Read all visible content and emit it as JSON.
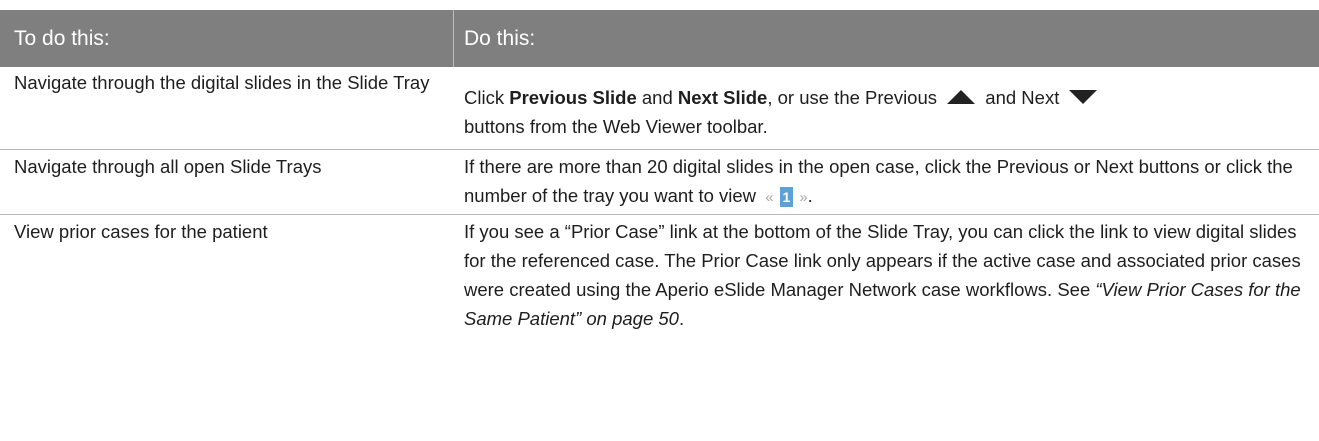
{
  "header": {
    "col1": "To do this:",
    "col2": "Do this:"
  },
  "rows": [
    {
      "task": "Navigate through the digital slides in the Slide Tray",
      "action": {
        "part1": "Click ",
        "bold1": "Previous Slide",
        "part2": " and ",
        "bold2": "Next Slide",
        "part3": ", or use the Previous ",
        "part4": " and Next ",
        "part5": "buttons from the Web Viewer toolbar."
      }
    },
    {
      "task": "Navigate through all open Slide Trays",
      "action": {
        "part1": "If there are more than 20 digital slides in the open case, click the Previous or Next buttons or click the number of the tray you want to view ",
        "page_prev": "«",
        "page_num": "1",
        "page_next": "»",
        "part2": "."
      }
    },
    {
      "task": "View prior cases for the patient",
      "action": {
        "part1": "If you see a “Prior Case” link at the bottom of the Slide Tray, you can click the link to view digital slides for the referenced case. The Prior Case link only appears if the active case and associated prior cases were created using the Aperio eSlide Manager Network case workflows. See ",
        "italic": "“View Prior Cases for the Same Patient” on page 50",
        "part2": "."
      }
    }
  ],
  "icons": {
    "previous": "triangle-up-icon",
    "next": "triangle-down-icon"
  },
  "colors": {
    "header_bg": "#7f7f7f",
    "icon": "#222222",
    "pager_highlight": "#5ea1d8"
  }
}
